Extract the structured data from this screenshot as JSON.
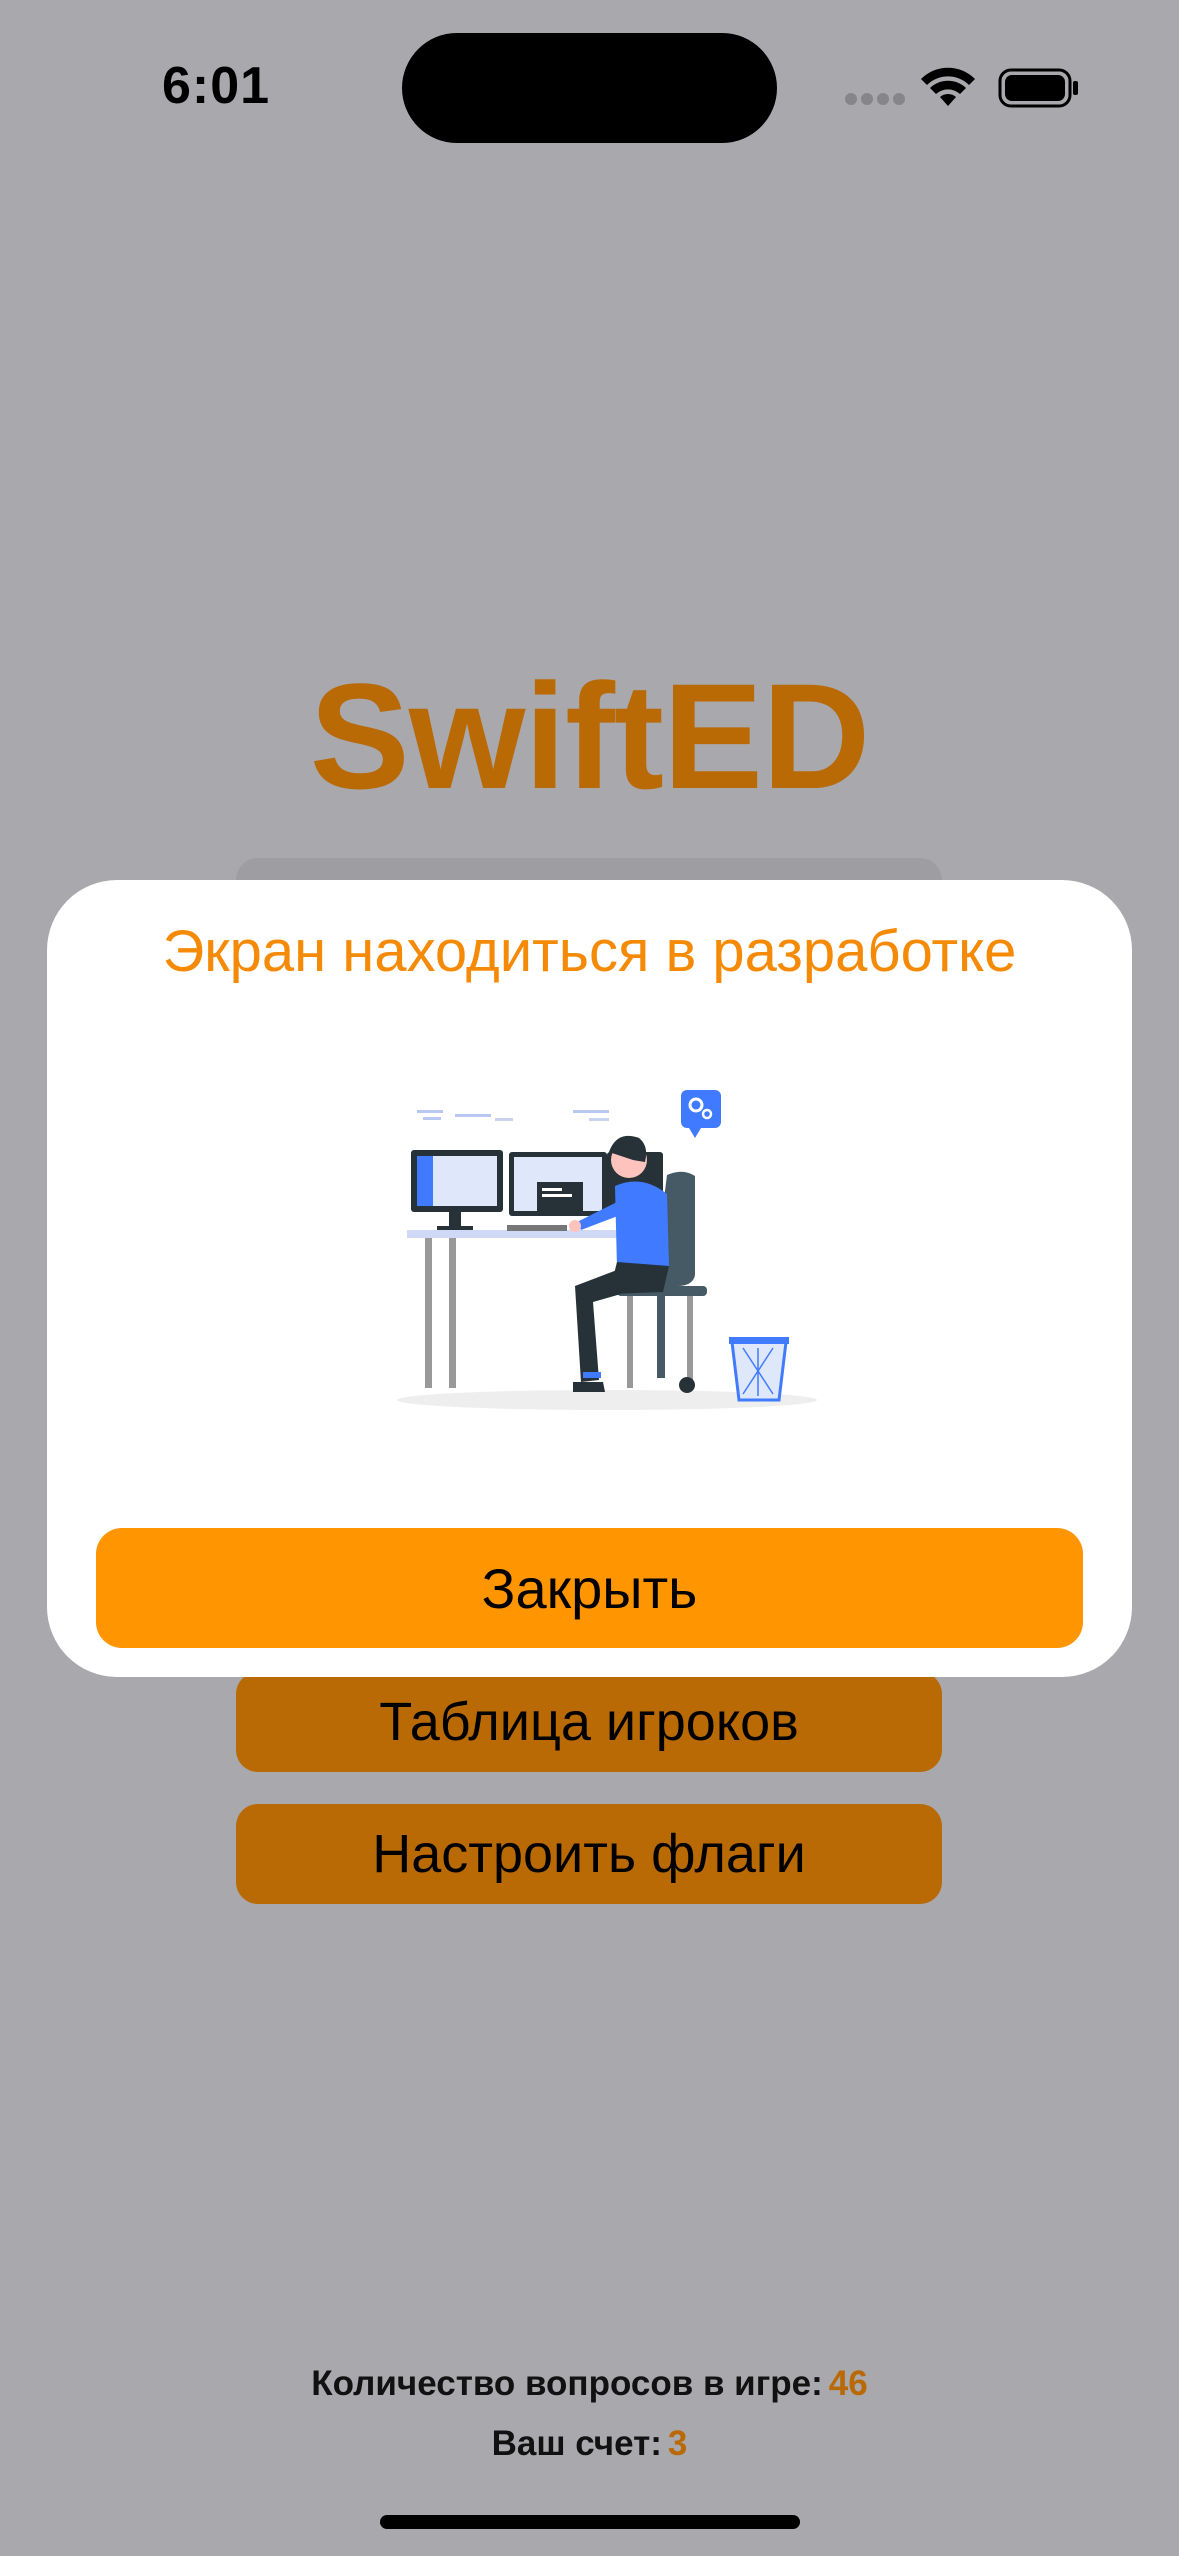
{
  "status_bar": {
    "time": "6:01"
  },
  "home": {
    "title": "SwiftED",
    "buttons": [
      {
        "label": "Таблица игроков"
      },
      {
        "label": "Настроить флаги"
      }
    ],
    "footer": {
      "questions_label": "Количество вопросов в игре:",
      "questions_value": "46",
      "score_label": "Ваш счет:",
      "score_value": "3"
    }
  },
  "modal": {
    "title": "Экран находиться в разработке",
    "illustration": "developer-at-desk-illustration",
    "close_label": "Закрыть"
  },
  "colors": {
    "accent": "#ff9500",
    "title_orange": "#b96a05",
    "modal_title": "#f58a07",
    "dim_background": "#a9a8ad"
  }
}
